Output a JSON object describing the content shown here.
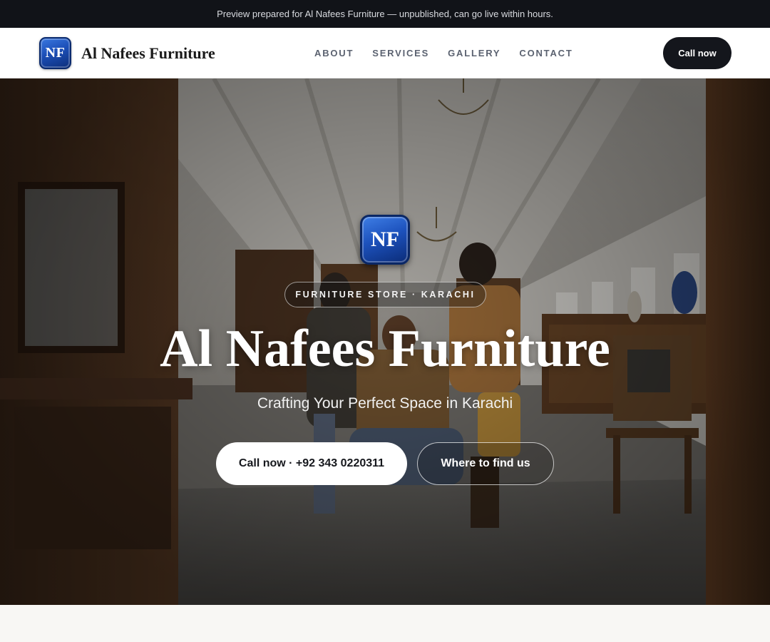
{
  "preview_bar": {
    "text": "Preview prepared for Al Nafees Furniture — unpublished, can go live within hours."
  },
  "header": {
    "logo_text": "NF",
    "brand_name": "Al Nafees Furniture",
    "nav": [
      {
        "label": "ABOUT"
      },
      {
        "label": "SERVICES"
      },
      {
        "label": "GALLERY"
      },
      {
        "label": "CONTACT"
      }
    ],
    "call_label": "Call now"
  },
  "hero": {
    "logo_text": "NF",
    "tag": "FURNITURE STORE · KARACHI",
    "title": "Al Nafees Furniture",
    "subtitle": "Crafting Your Perfect Space in Karachi",
    "primary_cta": "Call now · +92 343 0220311",
    "secondary_cta": "Where to find us",
    "background_image": "furniture-showroom-photo"
  },
  "colors": {
    "dark": "#111318",
    "button_dark": "#14161c",
    "logo_blue": "#1c4fb8",
    "page_bg": "#f8f7f4"
  }
}
